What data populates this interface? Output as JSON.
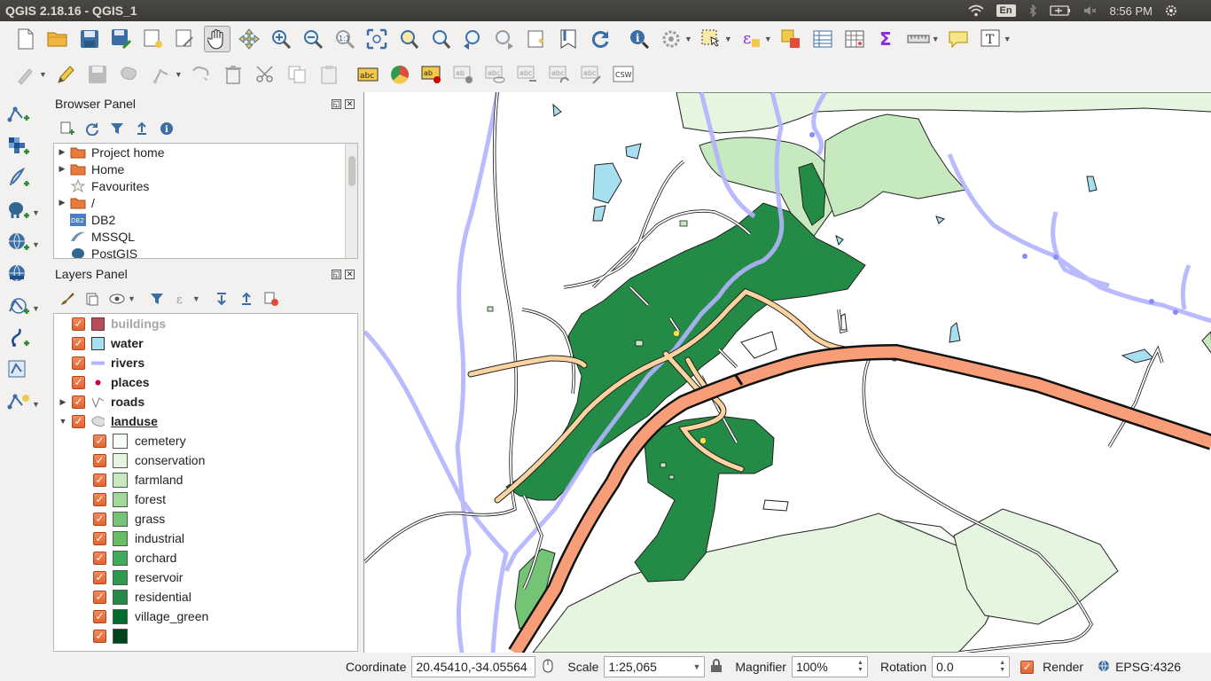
{
  "window": {
    "title": "QGIS 2.18.16 - QGIS_1"
  },
  "system_tray": {
    "language": "En",
    "time": "8:56 PM"
  },
  "toolbar1_icons": [
    "new-project-icon",
    "open-project-icon",
    "save-project-icon",
    "save-as-icon",
    "print-composer-icon",
    "composer-manager-icon",
    "pan-icon",
    "pan-to-selection-icon",
    "zoom-in-icon",
    "zoom-out-icon",
    "zoom-native-icon",
    "zoom-full-icon",
    "zoom-to-selection-icon",
    "zoom-to-layer-icon",
    "zoom-last-icon",
    "zoom-next-icon",
    "new-bookmark-icon",
    "show-bookmarks-icon",
    "refresh-icon",
    "identify-icon",
    "run-action-icon",
    "select-features-icon",
    "select-by-expression-icon",
    "deselect-icon",
    "attribute-table-icon",
    "field-calculator-icon",
    "statistics-icon",
    "measure-icon",
    "map-tips-icon",
    "text-annotation-icon"
  ],
  "browser_panel": {
    "title": "Browser Panel",
    "items": [
      {
        "label": "Project home",
        "icon": "folder-icon",
        "expandable": true
      },
      {
        "label": "Home",
        "icon": "folder-icon",
        "expandable": true
      },
      {
        "label": "Favourites",
        "icon": "star-icon",
        "expandable": false
      },
      {
        "label": "/",
        "icon": "folder-icon",
        "expandable": true
      },
      {
        "label": "DB2",
        "icon": "db2-icon",
        "expandable": false
      },
      {
        "label": "MSSQL",
        "icon": "mssql-icon",
        "expandable": false
      },
      {
        "label": "PostGIS",
        "icon": "postgis-icon",
        "expandable": false
      }
    ]
  },
  "layers_panel": {
    "title": "Layers Panel",
    "layers": [
      {
        "name": "buildings",
        "symbol": "fill",
        "color": "#b5505a",
        "dim": true
      },
      {
        "name": "water",
        "symbol": "fill",
        "color": "#a6dff0",
        "dim": false
      },
      {
        "name": "rivers",
        "symbol": "line",
        "color": "#b3b3ff",
        "dim": false
      },
      {
        "name": "places",
        "symbol": "point",
        "color": "#c9003e",
        "dim": false
      },
      {
        "name": "roads",
        "symbol": "line-multi",
        "color": "#777777",
        "dim": false
      },
      {
        "name": "landuse",
        "symbol": "categorized",
        "color": "#cccccc",
        "dim": false
      }
    ],
    "landuse_categories": [
      {
        "label": "cemetery",
        "color": "#f7fcf5"
      },
      {
        "label": "conservation",
        "color": "#e5f5e0"
      },
      {
        "label": "farmland",
        "color": "#c7e9c0"
      },
      {
        "label": "forest",
        "color": "#a1d99b"
      },
      {
        "label": "grass",
        "color": "#74c476"
      },
      {
        "label": "industrial",
        "color": "#66bd63"
      },
      {
        "label": "orchard",
        "color": "#41ab5d"
      },
      {
        "label": "reservoir",
        "color": "#2e9a4e"
      },
      {
        "label": "residential",
        "color": "#238b45"
      },
      {
        "label": "village_green",
        "color": "#006d2c"
      },
      {
        "label": "",
        "color": "#00441b"
      }
    ]
  },
  "statusbar": {
    "coordinate_label": "Coordinate",
    "coordinate_value": "20.45410,-34.05564",
    "scale_label": "Scale",
    "scale_value": "1:25,065",
    "magnifier_label": "Magnifier",
    "magnifier_value": "100%",
    "rotation_label": "Rotation",
    "rotation_value": "0.0",
    "render_label": "Render",
    "crs": "EPSG:4326"
  }
}
